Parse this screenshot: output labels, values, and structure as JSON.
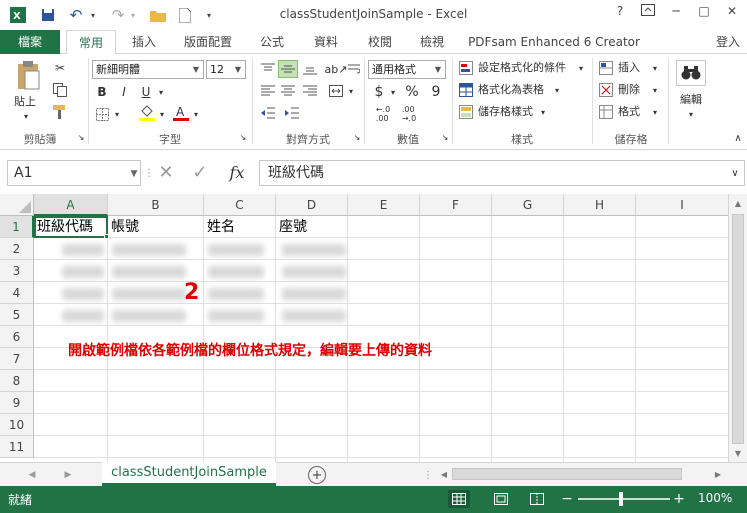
{
  "window": {
    "title": "classStudentJoinSample - Excel",
    "help": "?",
    "minimize": "─",
    "restore": "□",
    "close": "✕"
  },
  "tabs": {
    "file": "檔案",
    "items": [
      "常用",
      "插入",
      "版面配置",
      "公式",
      "資料",
      "校閱",
      "檢視",
      "PDFsam Enhanced 6 Creator"
    ],
    "login": "登入"
  },
  "ribbon": {
    "clipboard": {
      "paste": "貼上",
      "label": "剪貼簿"
    },
    "font": {
      "name": "新細明體",
      "size": "12",
      "bold": "B",
      "italic": "I",
      "underline": "U",
      "label": "字型"
    },
    "alignment": {
      "label": "對齊方式"
    },
    "number": {
      "format": "通用格式",
      "currency": "$",
      "percent": "%",
      "comma": "9",
      "label": "數值"
    },
    "styles": {
      "conditional": "設定格式化的條件",
      "as_table": "格式化為表格",
      "cell_styles": "儲存格樣式",
      "label": "樣式"
    },
    "cells": {
      "insert": "插入",
      "delete": "刪除",
      "format": "格式",
      "label": "儲存格"
    },
    "editing": {
      "label": "編輯"
    }
  },
  "formula_bar": {
    "name_box": "A1",
    "fx": "fx",
    "content": "班級代碼"
  },
  "grid": {
    "columns": [
      "A",
      "B",
      "C",
      "D",
      "E",
      "F",
      "G",
      "H",
      "I"
    ],
    "rows": [
      "1",
      "2",
      "3",
      "4",
      "5",
      "6",
      "7",
      "8",
      "9",
      "10",
      "11"
    ],
    "header_cells": [
      "班級代碼",
      "帳號",
      "姓名",
      "座號"
    ]
  },
  "annotation": {
    "number": "2",
    "text": "開啟範例檔依各範例檔的欄位格式規定，編輯要上傳的資料"
  },
  "sheet": {
    "name": "classStudentJoinSample",
    "add": "+"
  },
  "status": {
    "ready": "就緒",
    "zoom": "100%",
    "minus": "−",
    "plus": "+"
  },
  "colors": {
    "accent": "#217346",
    "annotation": "#e00000"
  }
}
